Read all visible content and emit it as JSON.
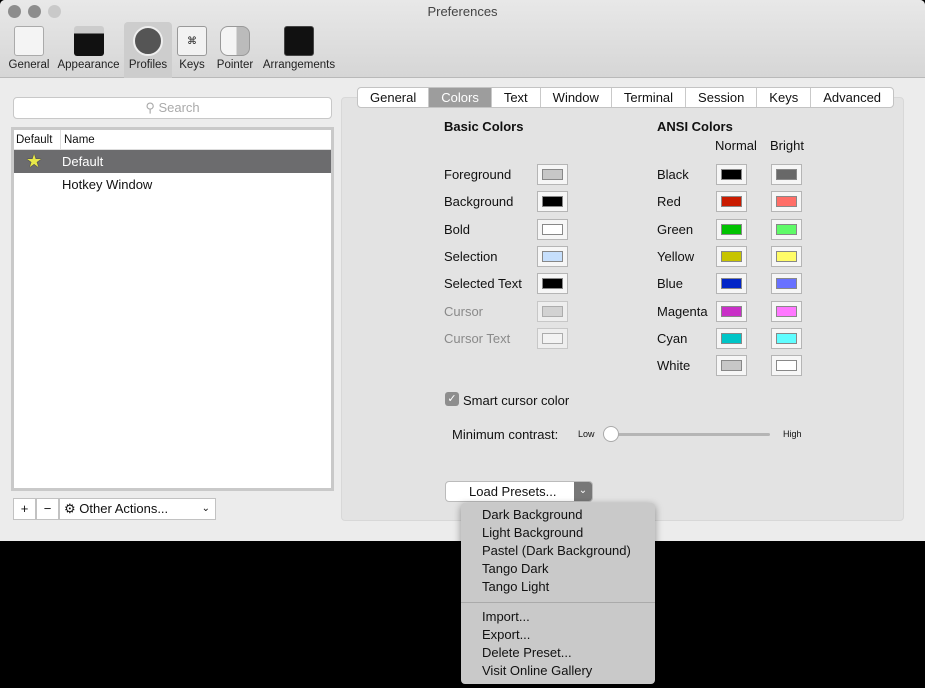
{
  "window": {
    "title": "Preferences"
  },
  "toolbar": [
    {
      "label": "General",
      "icon": "switch-icon"
    },
    {
      "label": "Appearance",
      "icon": "appearance-icon"
    },
    {
      "label": "Profiles",
      "icon": "profile-icon",
      "selected": true
    },
    {
      "label": "Keys",
      "icon": "command-key-icon"
    },
    {
      "label": "Pointer",
      "icon": "mouse-icon"
    },
    {
      "label": "Arrangements",
      "icon": "windows-icon"
    }
  ],
  "sidebar": {
    "search_placeholder": "Search",
    "col_default": "Default",
    "col_name": "Name",
    "profiles": [
      {
        "name": "Default",
        "default": true,
        "selected": true
      },
      {
        "name": "Hotkey Window"
      }
    ],
    "add": "+",
    "remove": "−",
    "other_actions": "Other Actions..."
  },
  "tabs": [
    {
      "label": "General"
    },
    {
      "label": "Colors",
      "selected": true
    },
    {
      "label": "Text"
    },
    {
      "label": "Window"
    },
    {
      "label": "Terminal"
    },
    {
      "label": "Session"
    },
    {
      "label": "Keys"
    },
    {
      "label": "Advanced"
    }
  ],
  "colors": {
    "basic_title": "Basic Colors",
    "ansi_title": "ANSI Colors",
    "normal": "Normal",
    "bright": "Bright",
    "basic": [
      {
        "label": "Foreground",
        "color": "#c7c7c7"
      },
      {
        "label": "Background",
        "color": "#000000"
      },
      {
        "label": "Bold",
        "color": "#ffffff"
      },
      {
        "label": "Selection",
        "color": "#c6dffc"
      },
      {
        "label": "Selected Text",
        "color": "#000000"
      },
      {
        "label": "Cursor",
        "color": "#c7c7c7",
        "disabled": true
      },
      {
        "label": "Cursor Text",
        "color": "#ffffff",
        "disabled": true
      }
    ],
    "ansi": [
      {
        "label": "Black",
        "normal": "#000000",
        "bright": "#686868"
      },
      {
        "label": "Red",
        "normal": "#c91b00",
        "bright": "#ff6e67"
      },
      {
        "label": "Green",
        "normal": "#00c200",
        "bright": "#5ffa68"
      },
      {
        "label": "Yellow",
        "normal": "#c7c400",
        "bright": "#fffc67"
      },
      {
        "label": "Blue",
        "normal": "#0225c7",
        "bright": "#6871ff"
      },
      {
        "label": "Magenta",
        "normal": "#c930c7",
        "bright": "#ff77ff"
      },
      {
        "label": "Cyan",
        "normal": "#00c5c7",
        "bright": "#60fdff"
      },
      {
        "label": "White",
        "normal": "#c7c7c7",
        "bright": "#ffffff"
      }
    ],
    "smart_cursor": {
      "label": "Smart cursor color",
      "checked": true
    },
    "min_contrast": {
      "label": "Minimum contrast:",
      "low": "Low",
      "high": "High",
      "value": 0
    },
    "load_presets": "Load Presets..."
  },
  "presets_menu": {
    "group1": [
      "Dark Background",
      "Light Background",
      "Pastel (Dark Background)",
      "Tango Dark",
      "Tango Light"
    ],
    "group2": [
      "Import...",
      "Export...",
      "Delete Preset...",
      "Visit Online Gallery"
    ]
  }
}
